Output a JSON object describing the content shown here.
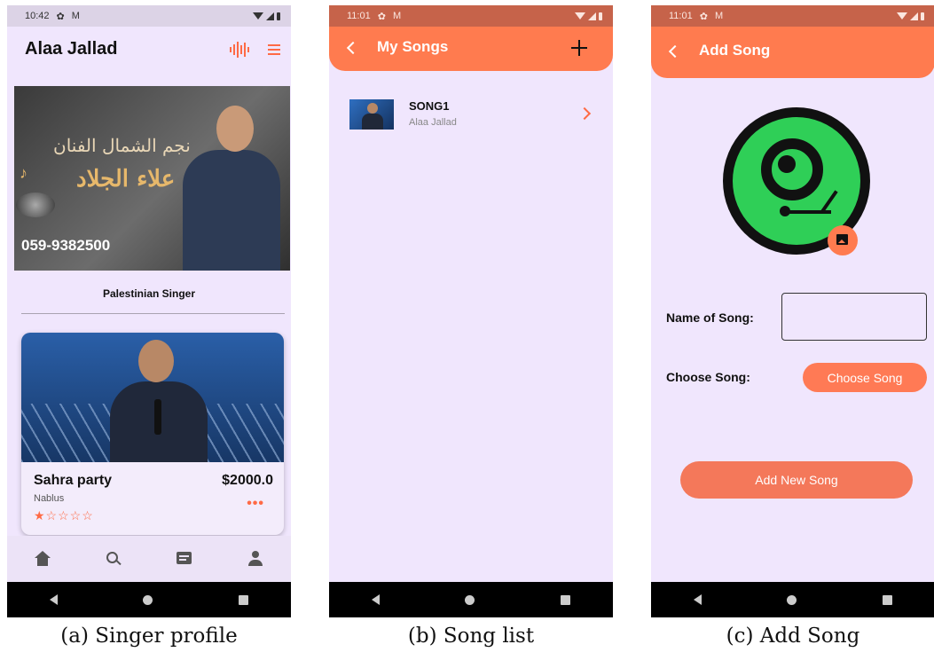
{
  "screens": {
    "profile": {
      "status_time": "10:42",
      "title": "Alaa Jallad",
      "banner": {
        "arabic_line1": "نجم الشمال الفنان",
        "arabic_line2": "علاء الجلاد",
        "phone": "059-9382500"
      },
      "subtitle": "Palestinian Singer",
      "event": {
        "name": "Sahra party",
        "price": "$2000.0",
        "location": "Nablus",
        "rating_stars": "★☆☆☆☆",
        "rating": 1,
        "rating_max": 5,
        "more": "•••"
      },
      "bottom_nav": [
        "home-icon",
        "search-icon",
        "chat-icon",
        "person-icon"
      ]
    },
    "songs": {
      "status_time": "11:01",
      "title": "My Songs",
      "add_icon": "plus-icon",
      "items": [
        {
          "title": "SONG1",
          "artist": "Alaa Jallad"
        }
      ]
    },
    "add_song": {
      "status_time": "11:01",
      "title": "Add Song",
      "name_label": "Name of Song:",
      "name_value": "",
      "choose_label": "Choose Song:",
      "choose_button": "Choose Song",
      "add_button": "Add New Song"
    }
  },
  "captions": [
    "(a) Singer profile",
    "(b) Song list",
    "(c) Add Song"
  ],
  "colors": {
    "accent": "#ff7b4f",
    "background": "#f0e6fd",
    "disc_green": "#2fcf57"
  }
}
